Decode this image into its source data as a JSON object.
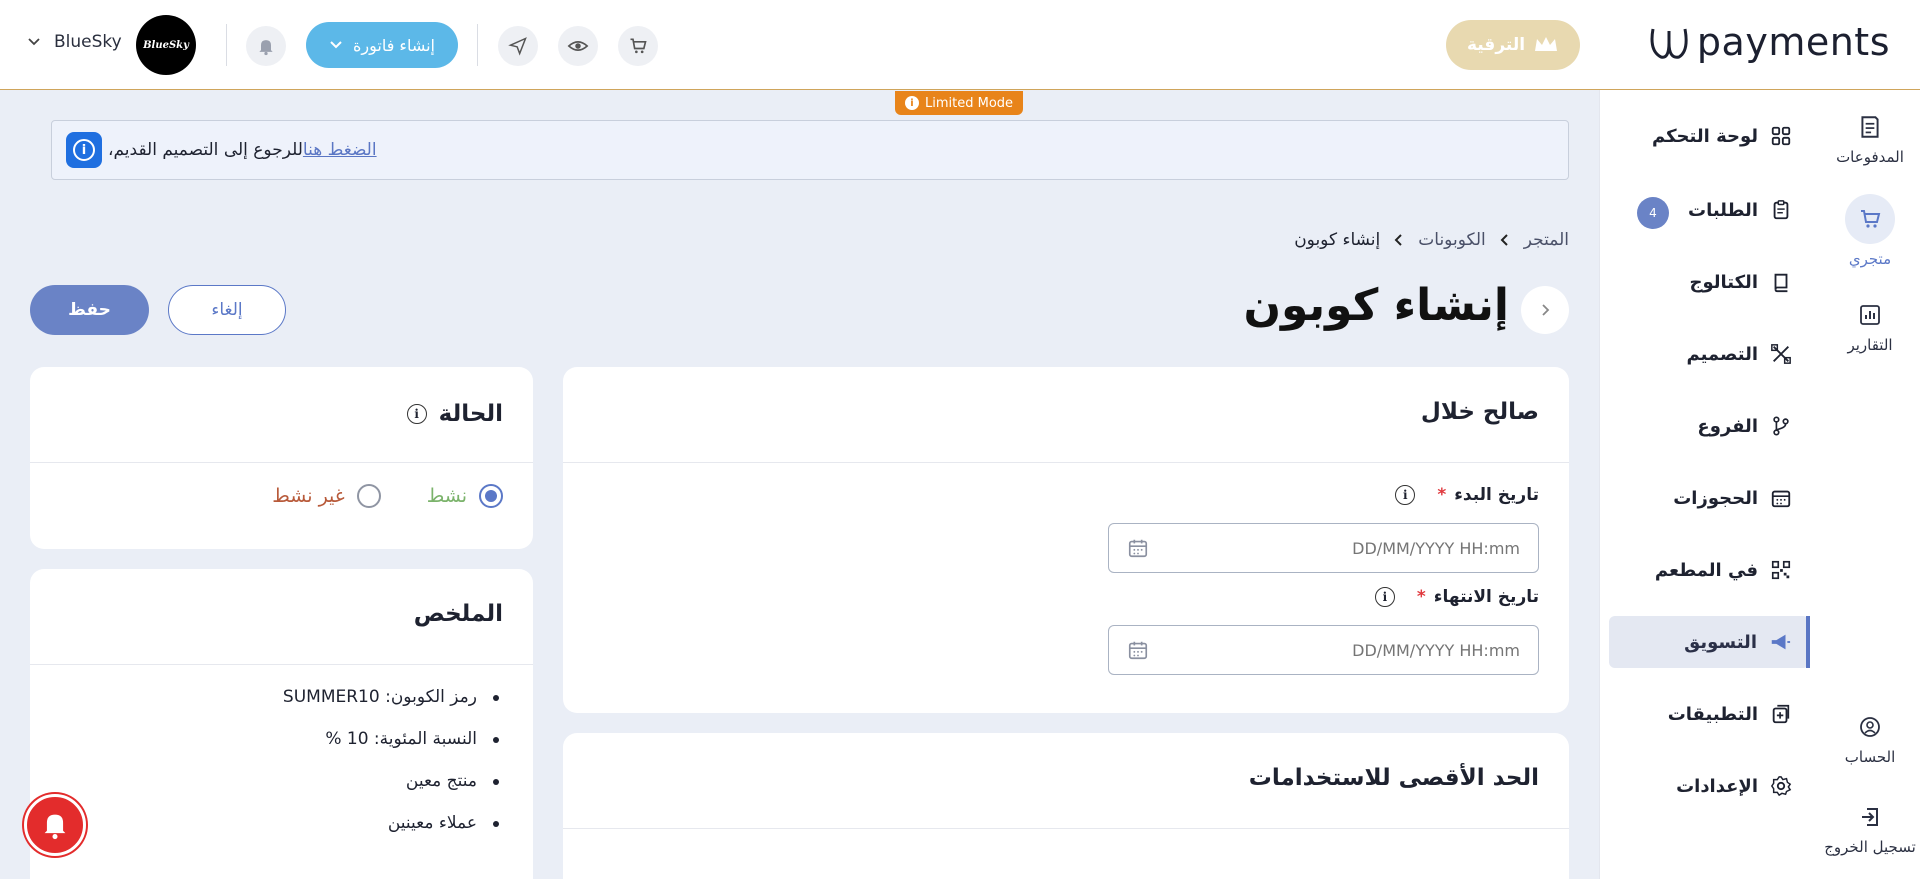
{
  "header": {
    "logo_text": "payments",
    "upgrade_label": "الترقية",
    "create_invoice_label": "إنشاء فاتورة",
    "user_name": "BlueSky",
    "avatar_text": "BlueSky",
    "limited_mode": "Limited Mode"
  },
  "notice": {
    "text": "للرجوع إلى التصميم القديم،",
    "link": "الضغط هنا"
  },
  "breadcrumb": {
    "items": [
      "المتجر",
      "الكوبونات",
      "إنشاء كوبون"
    ]
  },
  "page": {
    "title": "إنشاء كوبون",
    "save_label": "حفظ",
    "cancel_label": "إلغاء"
  },
  "validity": {
    "title": "صالح خلال",
    "start_label": "تاريخ البدء",
    "end_label": "تاريخ الانتهاء",
    "required_mark": "*",
    "start_placeholder": "DD/MM/YYYY HH:mm",
    "end_placeholder": "DD/MM/YYYY HH:mm"
  },
  "max_usage": {
    "title": "الحد الأقصى للاستخدامات"
  },
  "status": {
    "title": "الحالة",
    "active_label": "نشط",
    "inactive_label": "غير نشط",
    "selected": "active",
    "active_color": "#7bb36b",
    "inactive_color": "#b85a3a"
  },
  "summary": {
    "title": "الملخص",
    "items": [
      "رمز الكوبون: SUMMER10",
      "النسبة المئوية: 10 %",
      "منتج معين",
      "عملاء معينين"
    ]
  },
  "rail": {
    "payments": "المدفوعات",
    "store": "متجري",
    "reports": "التقارير",
    "account": "الحساب",
    "logout": "تسجيل الخروج"
  },
  "menu": {
    "dashboard": "لوحة التحكم",
    "orders": "الطلبات",
    "orders_badge": "4",
    "catalog": "الكتالوج",
    "design": "التصميم",
    "branches": "الفروع",
    "bookings": "الحجوزات",
    "dine_in": "في المطعم",
    "marketing": "التسويق",
    "apps": "التطبيقات",
    "settings": "الإعدادات"
  },
  "colors": {
    "accent": "#5b78c7",
    "upgrade_bg": "#e8d9b0",
    "invoice_btn": "#5cb8e8",
    "limited_mode": "#e8841a",
    "notification_red": "#e32c2c"
  }
}
